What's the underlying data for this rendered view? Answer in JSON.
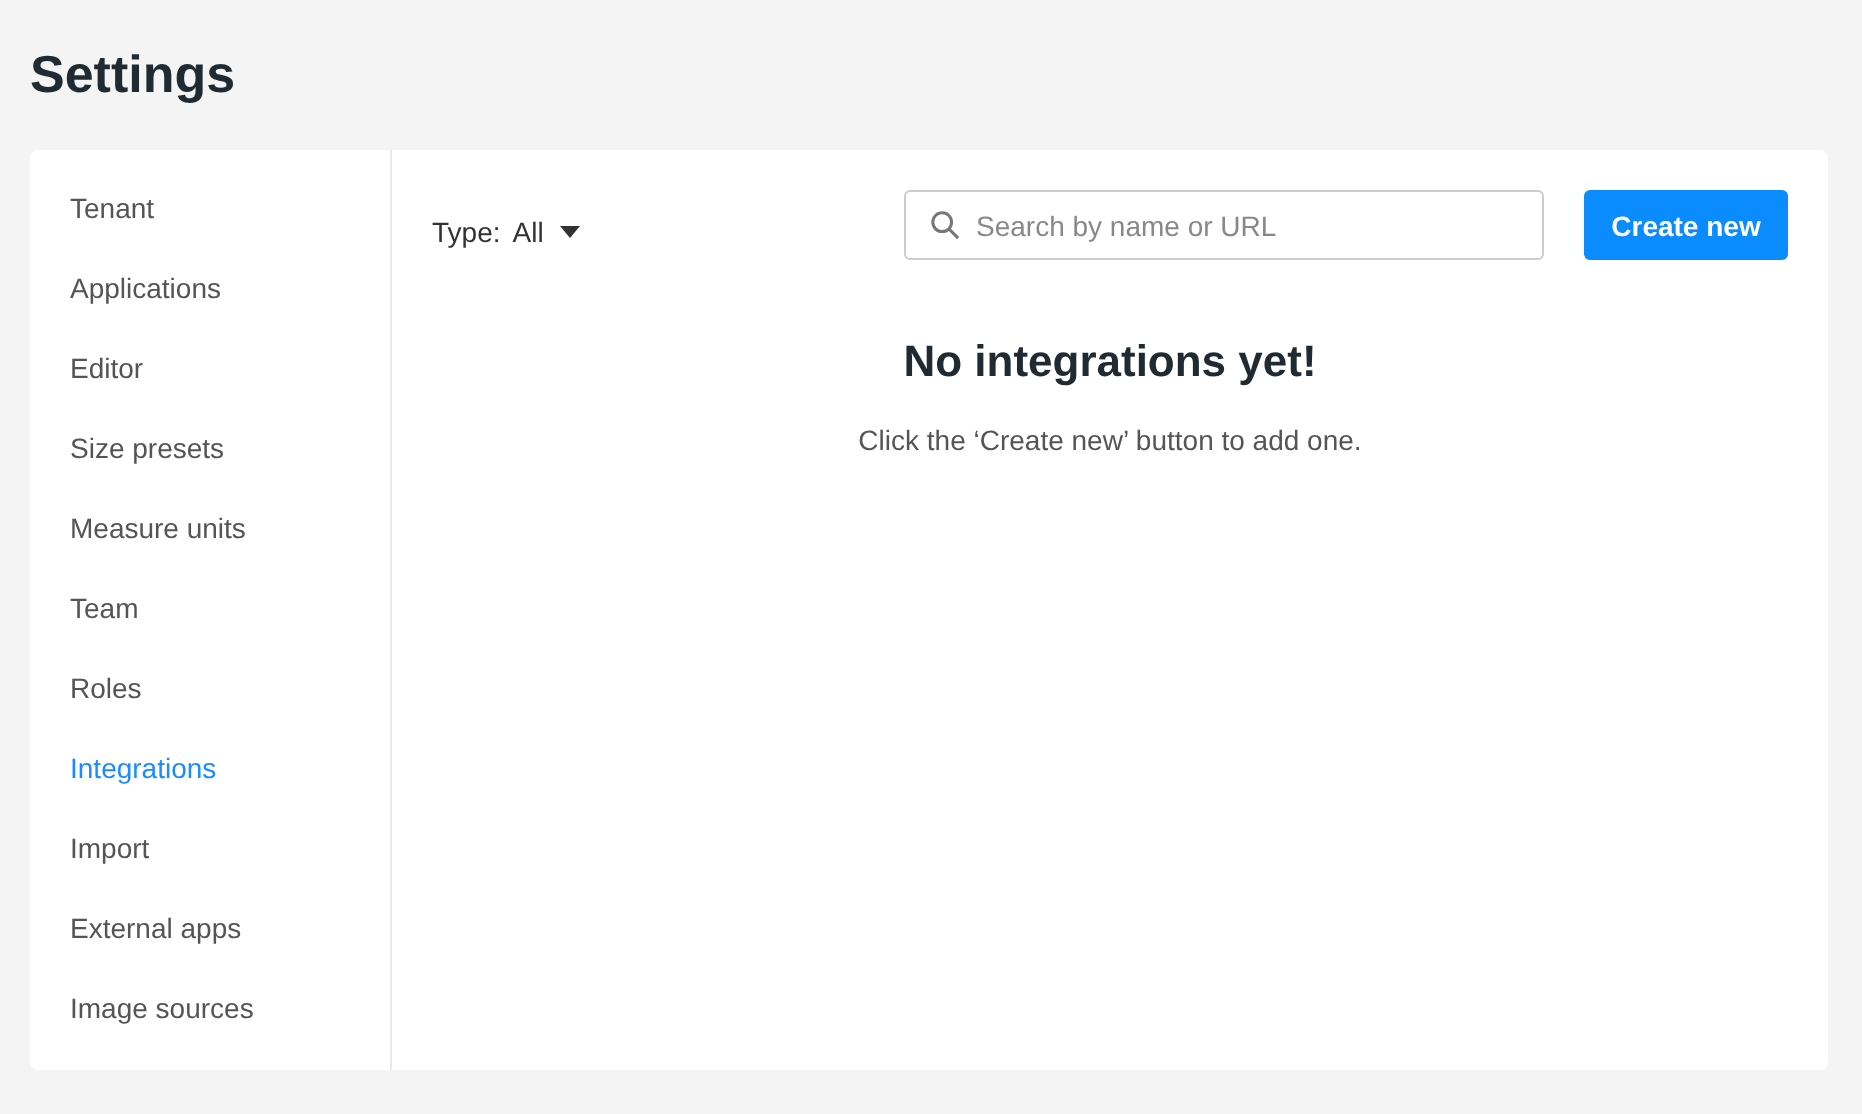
{
  "page": {
    "title": "Settings"
  },
  "sidebar": {
    "items": [
      {
        "label": "Tenant",
        "selected": false
      },
      {
        "label": "Applications",
        "selected": false
      },
      {
        "label": "Editor",
        "selected": false
      },
      {
        "label": "Size presets",
        "selected": false
      },
      {
        "label": "Measure units",
        "selected": false
      },
      {
        "label": "Team",
        "selected": false
      },
      {
        "label": "Roles",
        "selected": false
      },
      {
        "label": "Integrations",
        "selected": true
      },
      {
        "label": "Import",
        "selected": false
      },
      {
        "label": "External apps",
        "selected": false
      },
      {
        "label": "Image sources",
        "selected": false
      }
    ]
  },
  "toolbar": {
    "type_filter": {
      "label": "Type:",
      "value": "All"
    },
    "search": {
      "placeholder": "Search by name or URL"
    },
    "create_button": "Create new"
  },
  "empty_state": {
    "heading": "No integrations yet!",
    "message": "Click the ‘Create new’ button to add one."
  }
}
